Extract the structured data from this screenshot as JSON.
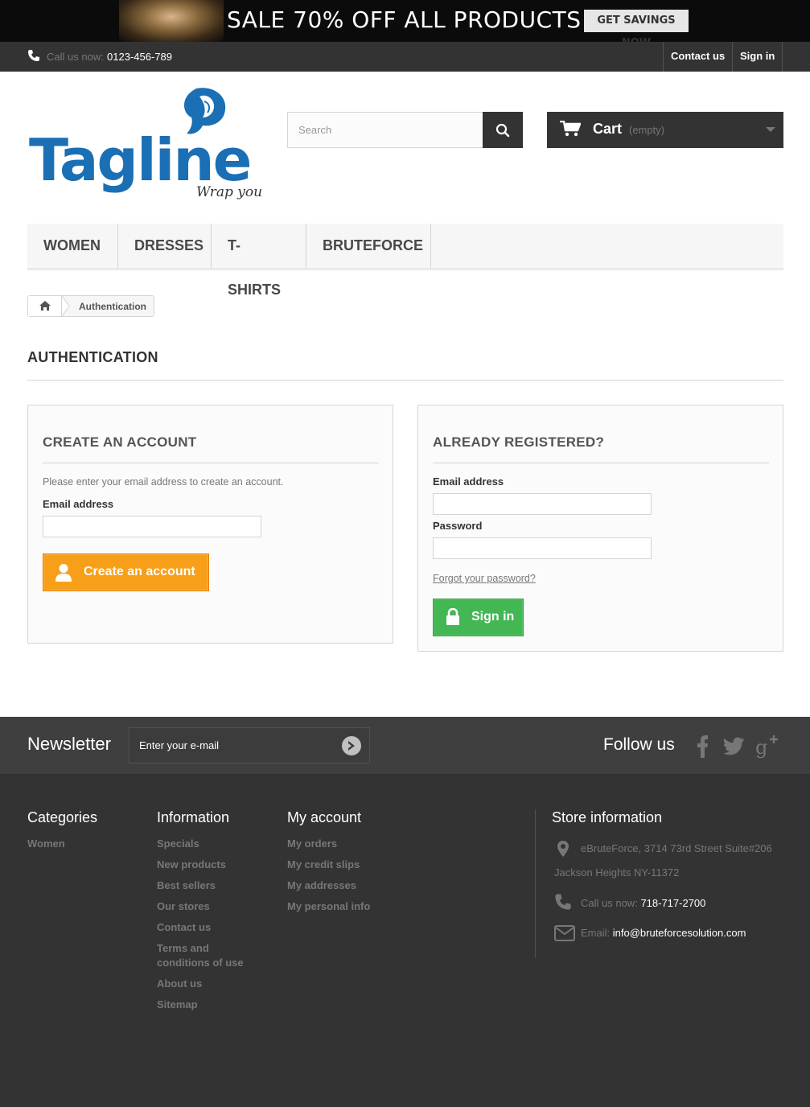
{
  "promo": {
    "headline": "SALE 70% OFF ALL PRODUCTS",
    "button": "GET SAVINGS NOW"
  },
  "topnav": {
    "call_label": "Call us now:",
    "call_number": "0123-456-789",
    "contact": "Contact us",
    "signin": "Sign in"
  },
  "header": {
    "logo_text": "Tagline",
    "logo_tagline": "Wrap you",
    "search_placeholder": "Search",
    "cart_label": "Cart",
    "cart_status": "(empty)"
  },
  "menu": [
    "WOMEN",
    "DRESSES",
    "T-SHIRTS",
    "BRUTEFORCE"
  ],
  "breadcrumb": {
    "current": "Authentication"
  },
  "page_title": "AUTHENTICATION",
  "create_account": {
    "title": "CREATE AN ACCOUNT",
    "intro": "Please enter your email address to create an account.",
    "email_label": "Email address",
    "email_value": "",
    "button": "Create an account"
  },
  "login": {
    "title": "ALREADY REGISTERED?",
    "email_label": "Email address",
    "email_value": "",
    "password_label": "Password",
    "password_value": "",
    "forgot": "Forgot your password?",
    "button": "Sign in"
  },
  "newsletter": {
    "title": "Newsletter",
    "placeholder": "Enter your e-mail",
    "follow": "Follow us"
  },
  "footer": {
    "categories": {
      "title": "Categories",
      "items": [
        "Women"
      ]
    },
    "information": {
      "title": "Information",
      "items": [
        "Specials",
        "New products",
        "Best sellers",
        "Our stores",
        "Contact us",
        "Terms and conditions of use",
        "About us",
        "Sitemap"
      ]
    },
    "account": {
      "title": "My account",
      "items": [
        "My orders",
        "My credit slips",
        "My addresses",
        "My personal info"
      ]
    },
    "store": {
      "title": "Store information",
      "address_line1": "eBruteForce, 3714 73rd Street Suite#206",
      "address_line2": "Jackson Heights NY-11372",
      "call_label": "Call us now:",
      "call_number": "718-717-2700",
      "email_label": "Email:",
      "email_value": "info@bruteforcesolution.com"
    }
  },
  "colors": {
    "create_button": "#f89f1a",
    "signin_button": "#43b754",
    "logo_blue": "#1a6fb5",
    "dark_bar": "#333333"
  }
}
